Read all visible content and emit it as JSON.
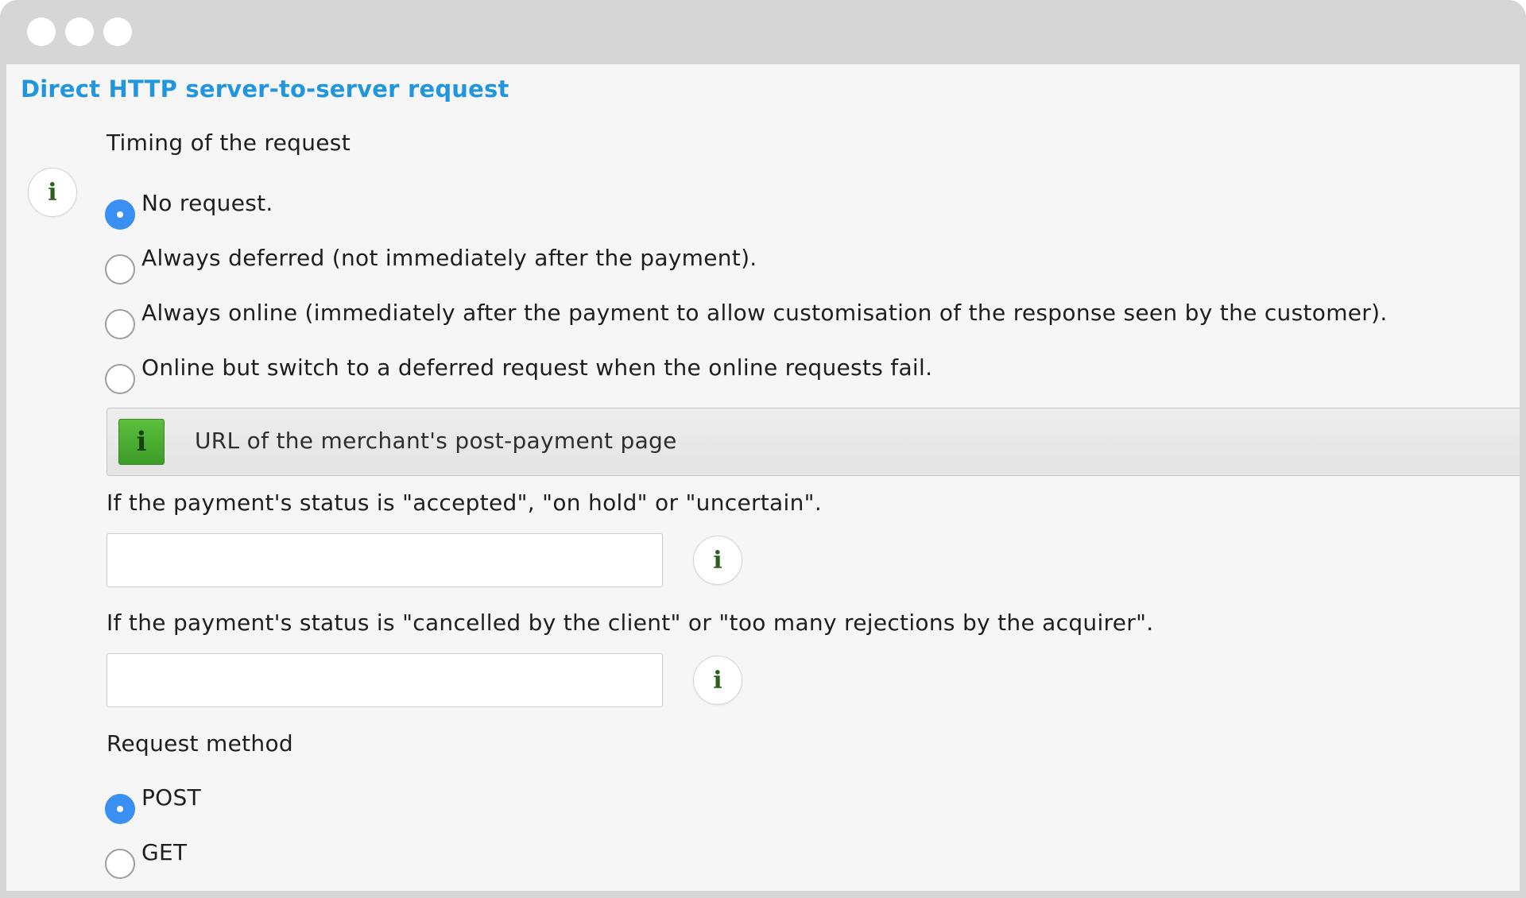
{
  "section_title": "Direct HTTP server-to-server request",
  "timing": {
    "label": "Timing of the request",
    "options": [
      {
        "label": "No request.",
        "checked": true
      },
      {
        "label": "Always deferred (not immediately after the payment).",
        "checked": false
      },
      {
        "label": "Always online (immediately after the payment to allow customisation of the response seen by the customer).",
        "checked": false
      },
      {
        "label": "Online but switch to a deferred request when the online requests fail.",
        "checked": false
      }
    ]
  },
  "url_section": {
    "title": "URL of the merchant's post-payment page",
    "accepted_label": "If the payment's status is \"accepted\", \"on hold\" or \"uncertain\".",
    "accepted_value": "",
    "cancelled_label": "If the payment's status is \"cancelled by the client\" or \"too many rejections by the acquirer\".",
    "cancelled_value": ""
  },
  "request_method": {
    "label": "Request method",
    "options": [
      {
        "label": "POST",
        "checked": true
      },
      {
        "label": "GET",
        "checked": false
      }
    ]
  },
  "icons": {
    "info_glyph": "i"
  },
  "colors": {
    "title_blue": "#2196dd",
    "radio_checked": "#3a8ff2",
    "info_green": "#4caf37"
  }
}
